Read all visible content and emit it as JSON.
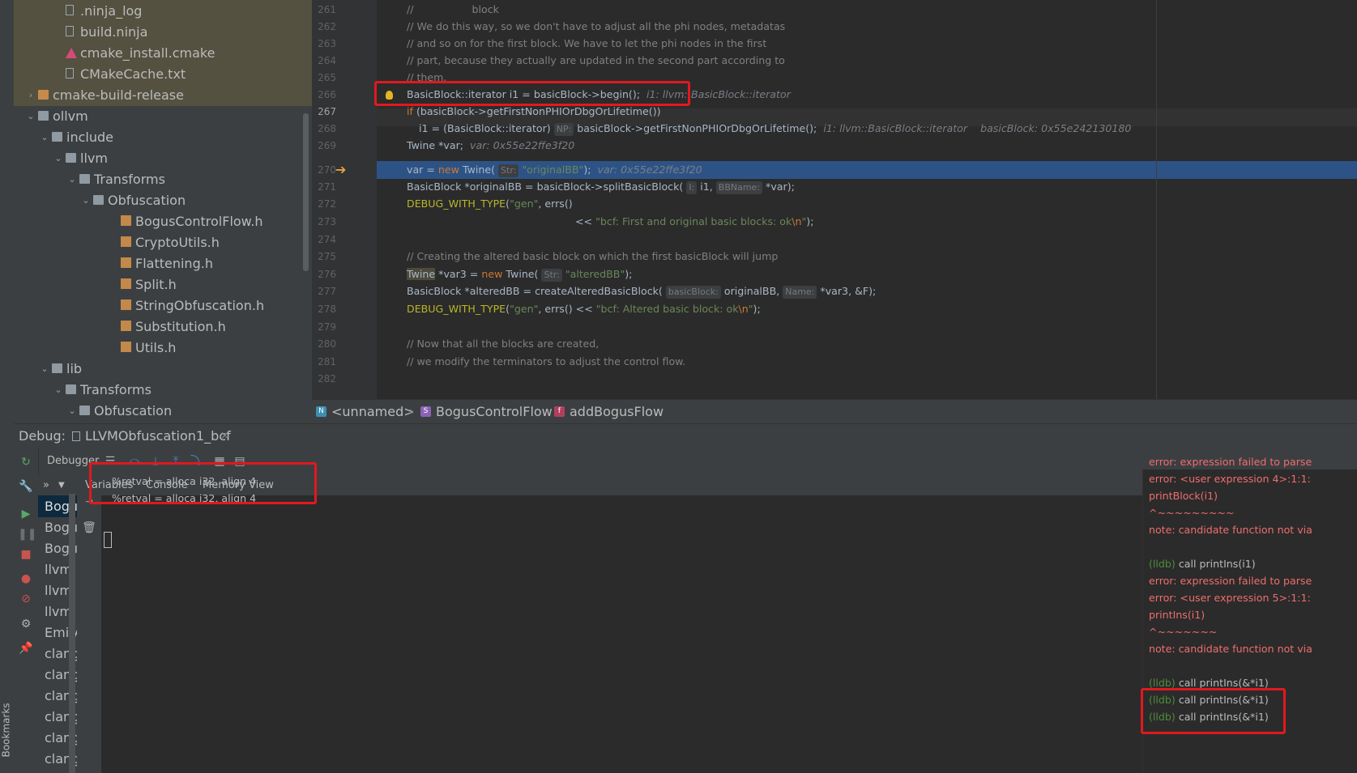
{
  "project_tree": [
    {
      "label": ".ninja_log",
      "icon": "file-icon",
      "indent": 4,
      "arrow": ""
    },
    {
      "label": "build.ninja",
      "icon": "file-icon",
      "indent": 4,
      "arrow": ""
    },
    {
      "label": "cmake_install.cmake",
      "icon": "cmake-icon",
      "indent": 4,
      "arrow": ""
    },
    {
      "label": "CMakeCache.txt",
      "icon": "file-icon",
      "indent": 4,
      "arrow": ""
    },
    {
      "label": "cmake-build-release",
      "icon": "folder-icon",
      "indent": 2,
      "arrow": "›"
    },
    {
      "label": "ollvm",
      "icon": "folder-icon",
      "indent": 2,
      "arrow": "⌄"
    },
    {
      "label": "include",
      "icon": "folder-icon",
      "indent": 3,
      "arrow": "⌄"
    },
    {
      "label": "llvm",
      "icon": "folder-icon",
      "indent": 4,
      "arrow": "⌄"
    },
    {
      "label": "Transforms",
      "icon": "folder-icon",
      "indent": 5,
      "arrow": "⌄"
    },
    {
      "label": "Obfuscation",
      "icon": "folder-icon",
      "indent": 6,
      "arrow": "⌄"
    },
    {
      "label": "BogusControlFlow.h",
      "icon": "header-file-icon",
      "indent": 8,
      "arrow": ""
    },
    {
      "label": "CryptoUtils.h",
      "icon": "header-file-icon",
      "indent": 8,
      "arrow": ""
    },
    {
      "label": "Flattening.h",
      "icon": "header-file-icon",
      "indent": 8,
      "arrow": ""
    },
    {
      "label": "Split.h",
      "icon": "header-file-icon",
      "indent": 8,
      "arrow": ""
    },
    {
      "label": "StringObfuscation.h",
      "icon": "header-file-icon",
      "indent": 8,
      "arrow": ""
    },
    {
      "label": "Substitution.h",
      "icon": "header-file-icon",
      "indent": 8,
      "arrow": ""
    },
    {
      "label": "Utils.h",
      "icon": "header-file-icon",
      "indent": 8,
      "arrow": ""
    },
    {
      "label": "lib",
      "icon": "folder-icon",
      "indent": 3,
      "arrow": "⌄"
    },
    {
      "label": "Transforms",
      "icon": "folder-icon",
      "indent": 4,
      "arrow": "⌄"
    },
    {
      "label": "Obfuscation",
      "icon": "folder-icon",
      "indent": 5,
      "arrow": "⌄"
    }
  ],
  "editor": {
    "line_numbers": [
      "261",
      "262",
      "263",
      "264",
      "265",
      "266",
      "267",
      "268",
      "269",
      "270",
      "271",
      "272",
      "273",
      "274",
      "275",
      "276",
      "277",
      "278",
      "279",
      "280",
      "281",
      "282"
    ],
    "line_261": "//                  block",
    "line_262": "// We do this way, so we don't have to adjust all the phi nodes, metadatas",
    "line_263": "// and so on for the first block. We have to let the phi nodes in the first",
    "line_264": "// part, because they actually are updated in the second part according to",
    "line_265": "// them.",
    "line_266_code": "BasicBlock::iterator i1 = basicBlock->begin();",
    "line_266_hint": "i1: llvm::BasicBlock::iterator",
    "line_267_kw": "if",
    "line_267_code": " (basicBlock->getFirstNonPHIOrDbgOrLifetime())",
    "line_268_a": "i1 = (BasicBlock::iterator)",
    "line_268_inlay": "NP:",
    "line_268_b": "basicBlock->getFirstNonPHIOrDbgOrLifetime();",
    "line_268_hint1": "i1: llvm::BasicBlock::iterator",
    "line_268_hint2": "basicBlock: 0x55e242130180",
    "line_269_code": "Twine *var;",
    "line_269_hint": "var: 0x55e22ffe3f20",
    "line_270_a": "var = ",
    "line_270_kw": "new",
    "line_270_b": " Twine(",
    "line_270_inlay": "Str:",
    "line_270_str": "\"originalBB\"",
    "line_270_c": ");",
    "line_270_hint": "var: 0x55e22ffe3f20",
    "line_271_a": "BasicBlock *originalBB = basicBlock->splitBasicBlock(",
    "line_271_inlay1": "I:",
    "line_271_b": "i1,",
    "line_271_inlay2": "BBName:",
    "line_271_c": "*var);",
    "line_272_mac": "DEBUG_WITH_TYPE",
    "line_272_a": "(",
    "line_272_str": "\"gen\"",
    "line_272_b": ", errs()",
    "line_273_a": "<< ",
    "line_273_str": "\"bcf: First and original basic blocks: ok",
    "line_273_esc": "\\n",
    "line_273_str2": "\"",
    "line_273_b": ");",
    "line_275": "// Creating the altered basic block on which the first basicBlock will jump",
    "line_276_a": "Twine",
    "line_276_b": " *var3 = ",
    "line_276_kw": "new",
    "line_276_c": " Twine(",
    "line_276_inlay": "Str:",
    "line_276_str": "\"alteredBB\"",
    "line_276_d": ");",
    "line_277_a": "BasicBlock *alteredBB = createAlteredBasicBlock(",
    "line_277_inlay1": "basicBlock:",
    "line_277_b": "originalBB,",
    "line_277_inlay2": "Name:",
    "line_277_c": "*var3, &F);",
    "line_278_mac": "DEBUG_WITH_TYPE",
    "line_278_a": "(",
    "line_278_str": "\"gen\"",
    "line_278_b": ", errs() << ",
    "line_278_str2": "\"bcf: Altered basic block: ok",
    "line_278_esc": "\\n",
    "line_278_str3": "\"",
    "line_278_c": ");",
    "line_280": "// Now that all the blocks are created,",
    "line_281": "// we modify the terminators to adjust the control flow."
  },
  "breadcrumb": {
    "ns": "<unnamed>",
    "ns_icon": "N",
    "cls": "BogusControlFlow",
    "cls_icon": "S",
    "fn": "addBogusFlow",
    "fn_icon": "f"
  },
  "debug": {
    "label": "Debug:",
    "session": "LLVMObfuscation1_bcf",
    "close": "×",
    "debugger_tab": "Debugger",
    "tabs": {
      "variables": "Variables",
      "console": "Console",
      "memory": "Memory View"
    },
    "frames_toggle": "»",
    "frames": [
      "Bogus",
      "Bogus",
      "Bogus",
      "llvm::",
      "llvm::",
      "llvm::",
      "EmitA",
      "clang:",
      "clang:",
      "clang:",
      "clang:",
      "clang:",
      "clang:"
    ],
    "console_lines": [
      "%retval = alloca i32, align 4",
      "%retval = alloca i32, align 4"
    ],
    "lldb_lines": [
      {
        "type": "err",
        "text": "error: expression failed to parse"
      },
      {
        "type": "err",
        "text": "error: <user expression 4>:1:1:"
      },
      {
        "type": "err",
        "text": "printBlock(i1)"
      },
      {
        "type": "err",
        "text": "^~~~~~~~~~"
      },
      {
        "type": "err",
        "text": "note: candidate function not via"
      },
      {
        "type": "blank",
        "text": ""
      },
      {
        "type": "cmd",
        "prompt": "(lldb)",
        "text": " call printIns(i1)"
      },
      {
        "type": "err",
        "text": "error: expression failed to parse"
      },
      {
        "type": "err",
        "text": "error: <user expression 5>:1:1:"
      },
      {
        "type": "err",
        "text": "printIns(i1)"
      },
      {
        "type": "err",
        "text": "^~~~~~~~"
      },
      {
        "type": "err",
        "text": "note: candidate function not via"
      },
      {
        "type": "blank",
        "text": ""
      },
      {
        "type": "cmd",
        "prompt": "(lldb)",
        "text": " call printIns(&*i1)"
      },
      {
        "type": "cmd",
        "prompt": "(lldb)",
        "text": " call printIns(&*i1)"
      },
      {
        "type": "cmd",
        "prompt": "(lldb)",
        "text": " call printIns(&*i1)"
      }
    ]
  },
  "sidebar": {
    "bookmarks": "Bookmarks"
  },
  "colors": {
    "annotation_box": "#e0191f",
    "exec_line": "#2d5386"
  }
}
